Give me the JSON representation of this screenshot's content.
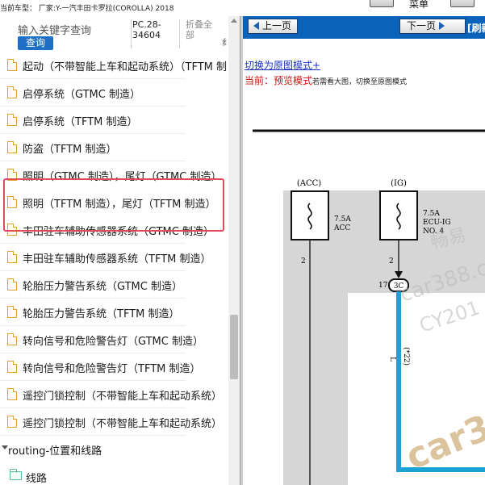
{
  "top": {
    "model_line": "当前车型： 厂家:Y-一汽丰田卡罗拉(COROLLA) 2018",
    "menu_label": "菜单"
  },
  "search": {
    "placeholder": "输入关键字查询",
    "button_label": "查询",
    "part_code": "PC.28-34604",
    "collapse_all": "折叠全部",
    "partial_char": "纟"
  },
  "tree": {
    "items": [
      {
        "label": "起动（不带智能上车和起动系统）（TFTM 制"
      },
      {
        "label": "启停系统（GTMC 制造）"
      },
      {
        "label": "启停系统（TFTM 制造）"
      },
      {
        "label": "防盗（TFTM 制造）"
      },
      {
        "label": "照明（GTMC 制造），尾灯（GTMC 制造）"
      },
      {
        "label": "照明（TFTM 制造），尾灯（TFTM 制造）"
      },
      {
        "label": "丰田驻车辅助传感器系统（GTMC 制造）"
      },
      {
        "label": "丰田驻车辅助传感器系统（TFTM 制造）"
      },
      {
        "label": "轮胎压力警告系统（GTMC 制造）"
      },
      {
        "label": "轮胎压力警告系统（TFTM 制造）"
      },
      {
        "label": "转向信号和危险警告灯（GTMC 制造）"
      },
      {
        "label": "转向信号和危险警告灯（TFTM 制造）"
      },
      {
        "label": "遥控门锁控制（不带智能上车和起动系统）"
      },
      {
        "label": "遥控门锁控制（不带智能上车和起动系统）"
      }
    ],
    "routing_label": "routing-位置和线路",
    "folder_label": "线路"
  },
  "nav": {
    "prev_label": "上一页",
    "next_label": "下一页",
    "refresh_label": "[刷新"
  },
  "viewer": {
    "switch_link": "切换为原图模式+",
    "mode_prefix": "当前：",
    "mode_name": "预览模式",
    "mode_hint": "若需看大图，切换至原图模式"
  },
  "diagram": {
    "fuse_acc_label": "(ACC)",
    "fuse_acc_rating": "7.5A",
    "fuse_acc_name": "ACC",
    "fuse_acc_pin": "2",
    "fuse_ig_label": "(IG)",
    "fuse_ig_rating": "7.5A",
    "fuse_ig_name1": "ECU-IG",
    "fuse_ig_name2": "NO. 4",
    "fuse_ig_pin": "2",
    "connector_pin": "17",
    "connector_id": "3C",
    "wire_color": "L",
    "wire_ref": "(*22)",
    "wire_color_hex": "#1aa3d4",
    "watermark_1": "畅易",
    "watermark_2": "car388.c",
    "watermark_3": "CY201",
    "watermark_4": "car3"
  }
}
